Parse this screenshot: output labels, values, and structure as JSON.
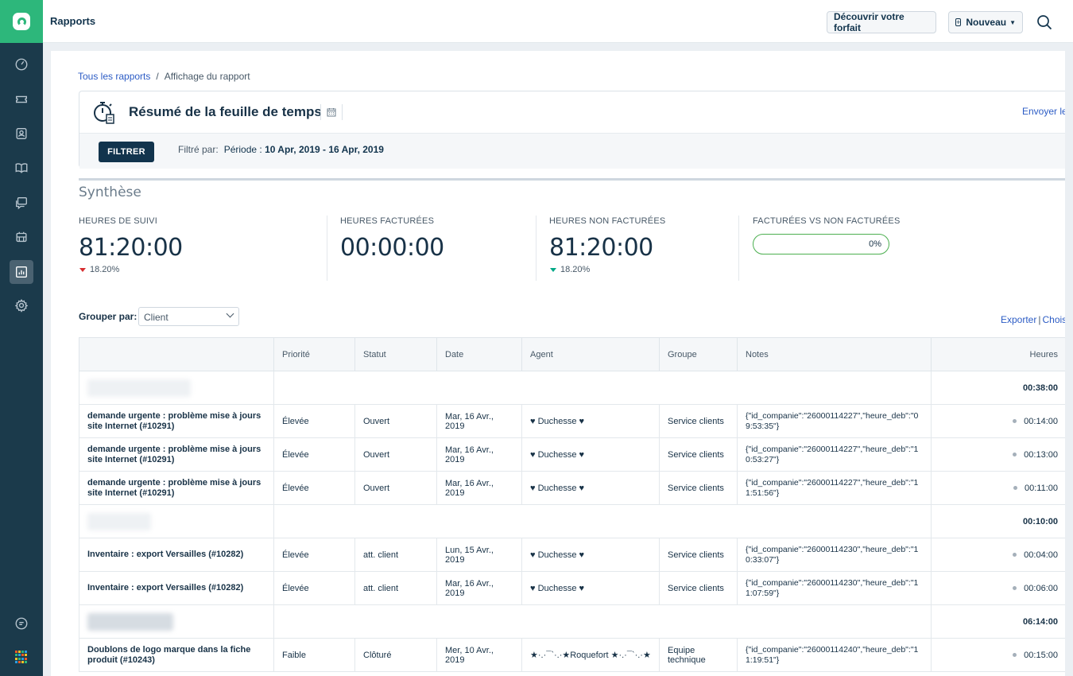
{
  "header": {
    "title": "Rapports",
    "discover_label": "Découvrir votre forfait",
    "new_label": "Nouveau"
  },
  "breadcrumb": {
    "all_reports": "Tous les rapports",
    "separator": "/",
    "current": "Affichage du rapport"
  },
  "report": {
    "title": "Résumé de la feuille de temps",
    "send_label": "Envoyer le",
    "filter_label": "FILTRER",
    "filtered_by": "Filtré par:",
    "period_label": "Période :",
    "period_value": "10 Apr, 2019 - 16 Apr, 2019"
  },
  "summary": {
    "title": "Synthèse",
    "metrics": [
      {
        "label": "HEURES DE SUIVI",
        "value": "81:20:00",
        "change": "18.20%",
        "trend": "down-red"
      },
      {
        "label": "HEURES FACTURÉES",
        "value": "00:00:00"
      },
      {
        "label": "HEURES NON FACTURÉES",
        "value": "81:20:00",
        "change": "18.20%",
        "trend": "down-green"
      },
      {
        "label": "FACTURÉES VS NON FACTURÉES",
        "progress": "0%",
        "progress_fraction": 0
      }
    ]
  },
  "grouping": {
    "label": "Grouper par:",
    "selected": "Client",
    "export_label": "Exporter",
    "separator": "|",
    "choose_label": "Chois"
  },
  "table": {
    "columns": [
      "",
      "Priorité",
      "Statut",
      "Date",
      "Agent",
      "Groupe",
      "Notes",
      "Heures"
    ],
    "groups": [
      {
        "total": "00:38:00",
        "rows": [
          {
            "ticket": "demande urgente : problème mise à jours site Internet (#10291)",
            "priority": "Élevée",
            "status": "Ouvert",
            "date": "Mar, 16 Avr., 2019",
            "agent": "♥ Duchesse ♥",
            "group": "Service clients",
            "notes": "{\"id_companie\":\"26000114227\",\"heure_deb\":\"09:53:35\"}",
            "hours": "00:14:00"
          },
          {
            "ticket": "demande urgente : problème mise à jours site Internet (#10291)",
            "priority": "Élevée",
            "status": "Ouvert",
            "date": "Mar, 16 Avr., 2019",
            "agent": "♥ Duchesse ♥",
            "group": "Service clients",
            "notes": "{\"id_companie\":\"26000114227\",\"heure_deb\":\"10:53:27\"}",
            "hours": "00:13:00"
          },
          {
            "ticket": "demande urgente : problème mise à jours site Internet (#10291)",
            "priority": "Élevée",
            "status": "Ouvert",
            "date": "Mar, 16 Avr., 2019",
            "agent": "♥ Duchesse ♥",
            "group": "Service clients",
            "notes": "{\"id_companie\":\"26000114227\",\"heure_deb\":\"11:51:56\"}",
            "hours": "00:11:00"
          }
        ]
      },
      {
        "total": "00:10:00",
        "rows": [
          {
            "ticket": "Inventaire : export Versailles (#10282)",
            "priority": "Élevée",
            "status": "att. client",
            "date": "Lun, 15 Avr., 2019",
            "agent": "♥ Duchesse ♥",
            "group": "Service clients",
            "notes": "{\"id_companie\":\"26000114230\",\"heure_deb\":\"10:33:07\"}",
            "hours": "00:04:00"
          },
          {
            "ticket": "Inventaire : export Versailles (#10282)",
            "priority": "Élevée",
            "status": "att. client",
            "date": "Mar, 16 Avr., 2019",
            "agent": "♥ Duchesse ♥",
            "group": "Service clients",
            "notes": "{\"id_companie\":\"26000114230\",\"heure_deb\":\"11:07:59\"}",
            "hours": "00:06:00"
          }
        ]
      },
      {
        "total": "06:14:00",
        "rows": [
          {
            "ticket": "Doublons de logo marque dans la fiche produit (#10243)",
            "priority": "Faible",
            "status": "Clôturé",
            "date": "Mer, 10 Avr., 2019",
            "agent": "★·.·¯`·.·★Roquefort ★·.·¯`·.·★",
            "group": "Equipe technique",
            "notes": "{\"id_companie\":\"26000114240\",\"heure_deb\":\"11:19:51\"}",
            "hours": "00:15:00"
          }
        ]
      }
    ]
  },
  "colors": {
    "sidebar": "#1b3a4b",
    "brand": "#2db77b",
    "link": "#2c5cc5",
    "primary_button": "#12344d",
    "trend_down": "#d72d30",
    "trend_good": "#00a886"
  },
  "icons": [
    "dashboard-icon",
    "tickets-icon",
    "contacts-icon",
    "knowledge-base-icon",
    "forums-icon",
    "bots-icon",
    "reports-icon",
    "settings-icon",
    "chat-icon",
    "apps-grid-icon",
    "search-icon",
    "stopwatch-icon",
    "calendar-icon"
  ]
}
